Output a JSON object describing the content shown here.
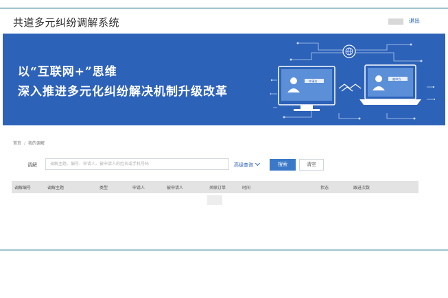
{
  "header": {
    "app_title": "共道多元纠纷调解系统",
    "logout_label": "退出"
  },
  "banner": {
    "slogan_line1": "以“互联网+”思维",
    "slogan_line2": "深入推进多元化纠纷解决机制升级改革",
    "left_screen_label": "申请方",
    "right_screen_label": "被申方"
  },
  "breadcrumb": {
    "items": [
      "首页",
      "我的调解"
    ]
  },
  "search": {
    "label": "调解",
    "placeholder": "调解主题、编号、申请人、被申请人的姓名或手机号码",
    "advanced_label": "高级查询",
    "search_button": "搜索",
    "clear_button": "清空"
  },
  "table": {
    "columns": [
      "调解编号",
      "调解主题",
      "类型",
      "申请人",
      "被申请人",
      "关联订单",
      "时间",
      "状态",
      "跟进次数"
    ]
  },
  "colors": {
    "banner_blue": "#2d62b9",
    "accent_blue": "#3a78c8",
    "rule_teal": "#9ec3cf"
  }
}
